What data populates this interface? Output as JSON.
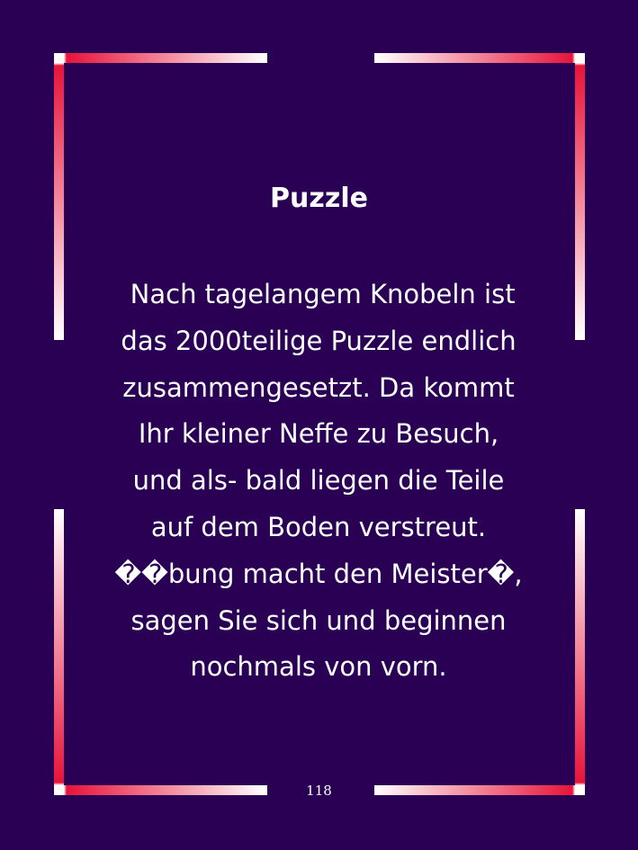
{
  "page": {
    "title": "Puzzle",
    "body_lines": [
      " Nach tagelangem Knobeln ist",
      "das 2000teilige Puzzle endlich",
      "zusammengesetzt. Da kommt",
      "Ihr kleiner Neffe zu Besuch,",
      "und als- bald liegen die Teile",
      "auf dem Boden verstreut.",
      "��bung macht den Meister�,",
      "sagen Sie sich und beginnen",
      "nochmals von vorn."
    ],
    "page_number": "118"
  },
  "colors": {
    "background": "#2a0055",
    "frame_accent": "#e8133a",
    "frame_highlight": "#ffffff",
    "text": "#ffffff"
  }
}
